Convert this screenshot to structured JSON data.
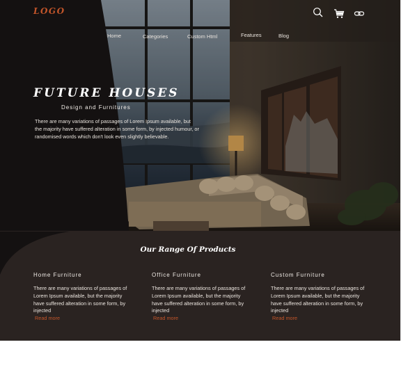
{
  "header": {
    "logo": "LOGO",
    "nav": [
      "Home",
      "Categories",
      "Custom Html",
      "Features",
      "Blog"
    ],
    "icons": [
      "search-icon",
      "cart-icon",
      "link-icon"
    ]
  },
  "hero": {
    "title": "FUTURE HOUSES",
    "subtitle": "Design and Furnitures",
    "text": "There are many variations of passages of Lorem Ipsum available, but the majority have suffered alteration in some form, by injected humour, or randomised words which don't look even slightly believable."
  },
  "products": {
    "title": "Our Range Of Products",
    "items": [
      {
        "name": "Home Furniture",
        "desc": "There are many variations of passages of Lorem Ipsum available, but the majority have suffered alteration in some form, by injected",
        "link": "Read more"
      },
      {
        "name": "Office Furniture",
        "desc": "There are many variations of passages of Lorem Ipsum available, but the majority have suffered alteration in some form, by injected",
        "link": "Read more"
      },
      {
        "name": "Custom Furniture",
        "desc": "There are many variations of passages of Lorem Ipsum available, but the majority have suffered alteration in some form, by injected",
        "link": "Read more"
      }
    ]
  },
  "colors": {
    "accent": "#c2552a",
    "dark": "#141111",
    "section": "#2a2321"
  }
}
